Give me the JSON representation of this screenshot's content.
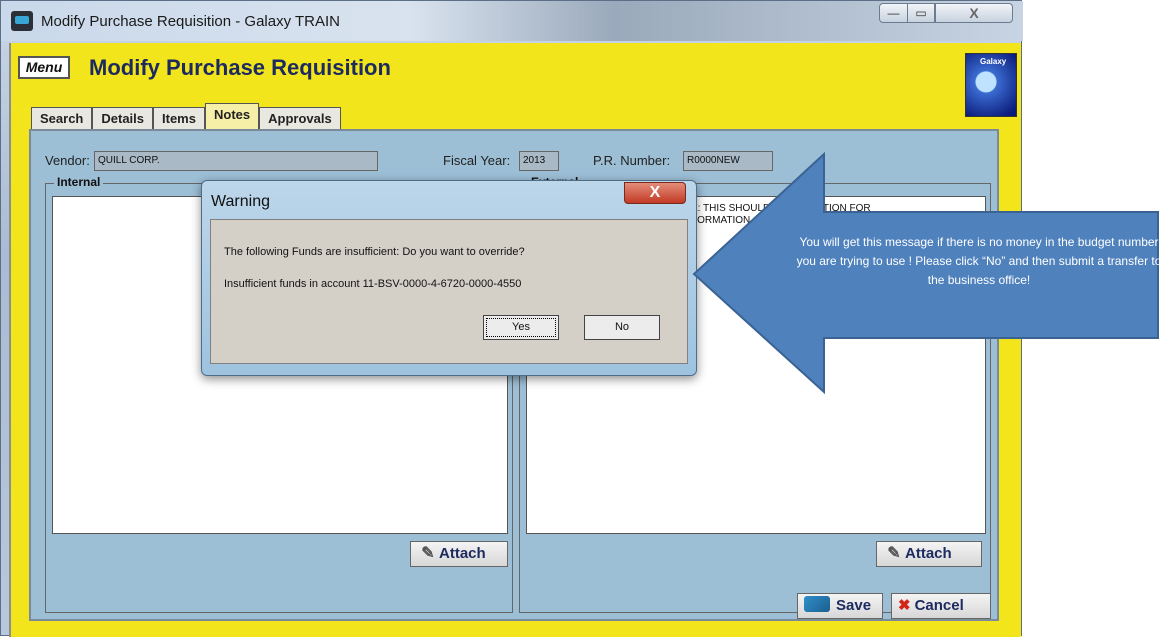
{
  "window": {
    "title": "Modify Purchase Requisition - Galaxy TRAIN",
    "min_glyph": "—",
    "max_glyph": "▭",
    "close_glyph": "X"
  },
  "app": {
    "menu_label": "Menu",
    "page_title": "Modify Purchase Requisition",
    "logo_text": "Galaxy"
  },
  "tabs": [
    {
      "label": "Search",
      "active": false
    },
    {
      "label": "Details",
      "active": false
    },
    {
      "label": "Items",
      "active": false
    },
    {
      "label": "Notes",
      "active": true
    },
    {
      "label": "Approvals",
      "active": false
    }
  ],
  "form": {
    "vendor_label": "Vendor:",
    "vendor_value": "QUILL CORP.",
    "fiscal_year_label": "Fiscal Year:",
    "fiscal_year_value": "2013",
    "pr_number_label": "P.R. Number:",
    "pr_number_value": "R0000NEW"
  },
  "notes": {
    "internal_title": "Internal",
    "external_title": "External",
    "external_text_line1": "E: THIS SHOULD      JUSTIFICATION FOR",
    "external_text_line2": "FORMATION",
    "attach_label": "Attach"
  },
  "actions": {
    "save_label": "Save",
    "cancel_label": "Cancel"
  },
  "dialog": {
    "title": "Warning",
    "close_glyph": "X",
    "message_line1": "The following Funds are insufficient:   Do you want to override?",
    "message_line2": "Insufficient funds in account 11-BSV-0000-4-6720-0000-4550",
    "yes_label": "Yes",
    "no_label": "No"
  },
  "annotation": {
    "text": "You will get this message if there is no money in the budget number you are trying to use !  Please  click “No” and then submit a transfer to the business office!",
    "arrow_color": "#4f81bd"
  }
}
